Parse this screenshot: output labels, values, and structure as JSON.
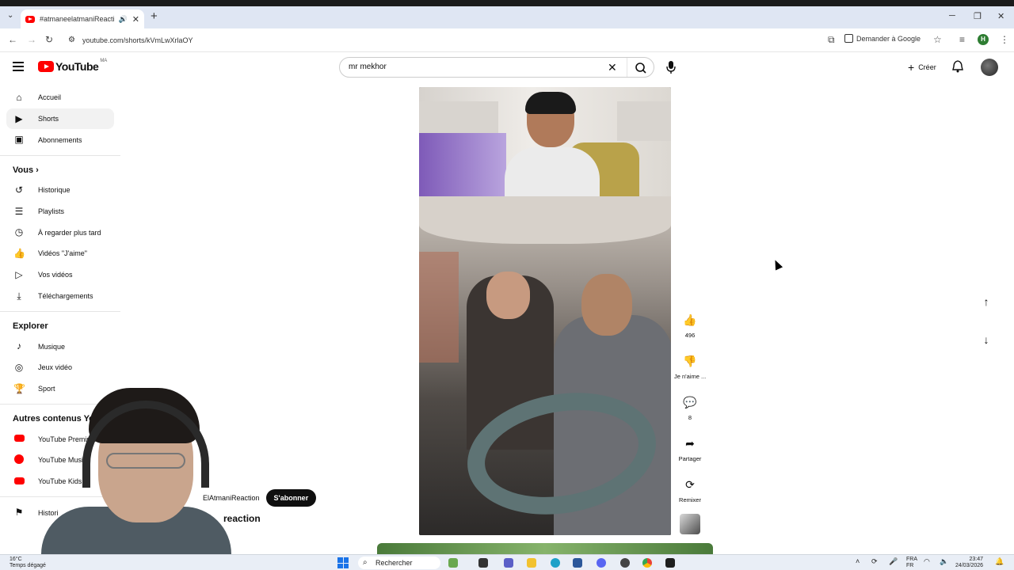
{
  "browser": {
    "tab_title": "#atmaneelatmaniReaction",
    "url": "youtube.com/shorts/kVmLwXrlaOY",
    "ask_google_label": "Demander à Google",
    "profile_initial": "H"
  },
  "header": {
    "logo_text": "YouTube",
    "logo_country": "MA",
    "search_value": "mr mekhor",
    "create_label": "Créer"
  },
  "sidebar": {
    "main": [
      {
        "label": "Accueil",
        "icon": "home-icon"
      },
      {
        "label": "Shorts",
        "icon": "shorts-icon"
      },
      {
        "label": "Abonnements",
        "icon": "subscriptions-icon"
      }
    ],
    "you_heading": "Vous",
    "you": [
      {
        "label": "Historique",
        "icon": "history-icon"
      },
      {
        "label": "Playlists",
        "icon": "playlists-icon"
      },
      {
        "label": "À regarder plus tard",
        "icon": "watch-later-icon"
      },
      {
        "label": "Vidéos \"J'aime\"",
        "icon": "liked-icon"
      },
      {
        "label": "Vos vidéos",
        "icon": "your-videos-icon"
      },
      {
        "label": "Téléchargements",
        "icon": "downloads-icon"
      }
    ],
    "explore_heading": "Explorer",
    "explore": [
      {
        "label": "Musique",
        "icon": "music-icon"
      },
      {
        "label": "Jeux vidéo",
        "icon": "gaming-icon"
      },
      {
        "label": "Sport",
        "icon": "sport-icon"
      }
    ],
    "more_heading": "Autres contenus YouTub",
    "more": [
      {
        "label": "YouTube Premium",
        "icon": "yt-premium-icon"
      },
      {
        "label": "YouTube Music",
        "icon": "yt-music-icon"
      },
      {
        "label": "YouTube Kids",
        "icon": "yt-kids-icon"
      }
    ],
    "report_label": "Histori"
  },
  "short": {
    "channel_name": "ElAtmaniReaction",
    "subscribe_label": "S'abonner",
    "title_fragment": "reaction",
    "like_count": "496",
    "dislike_label": "Je n'aime ...",
    "comment_count": "8",
    "share_label": "Partager",
    "remix_label": "Remixer"
  },
  "taskbar": {
    "weather_temp": "16°C",
    "weather_desc": "Temps dégagé",
    "search_label": "Rechercher",
    "lang_1": "FRA",
    "lang_2": "FR",
    "time": "23:47",
    "date": "24/03/2026"
  }
}
